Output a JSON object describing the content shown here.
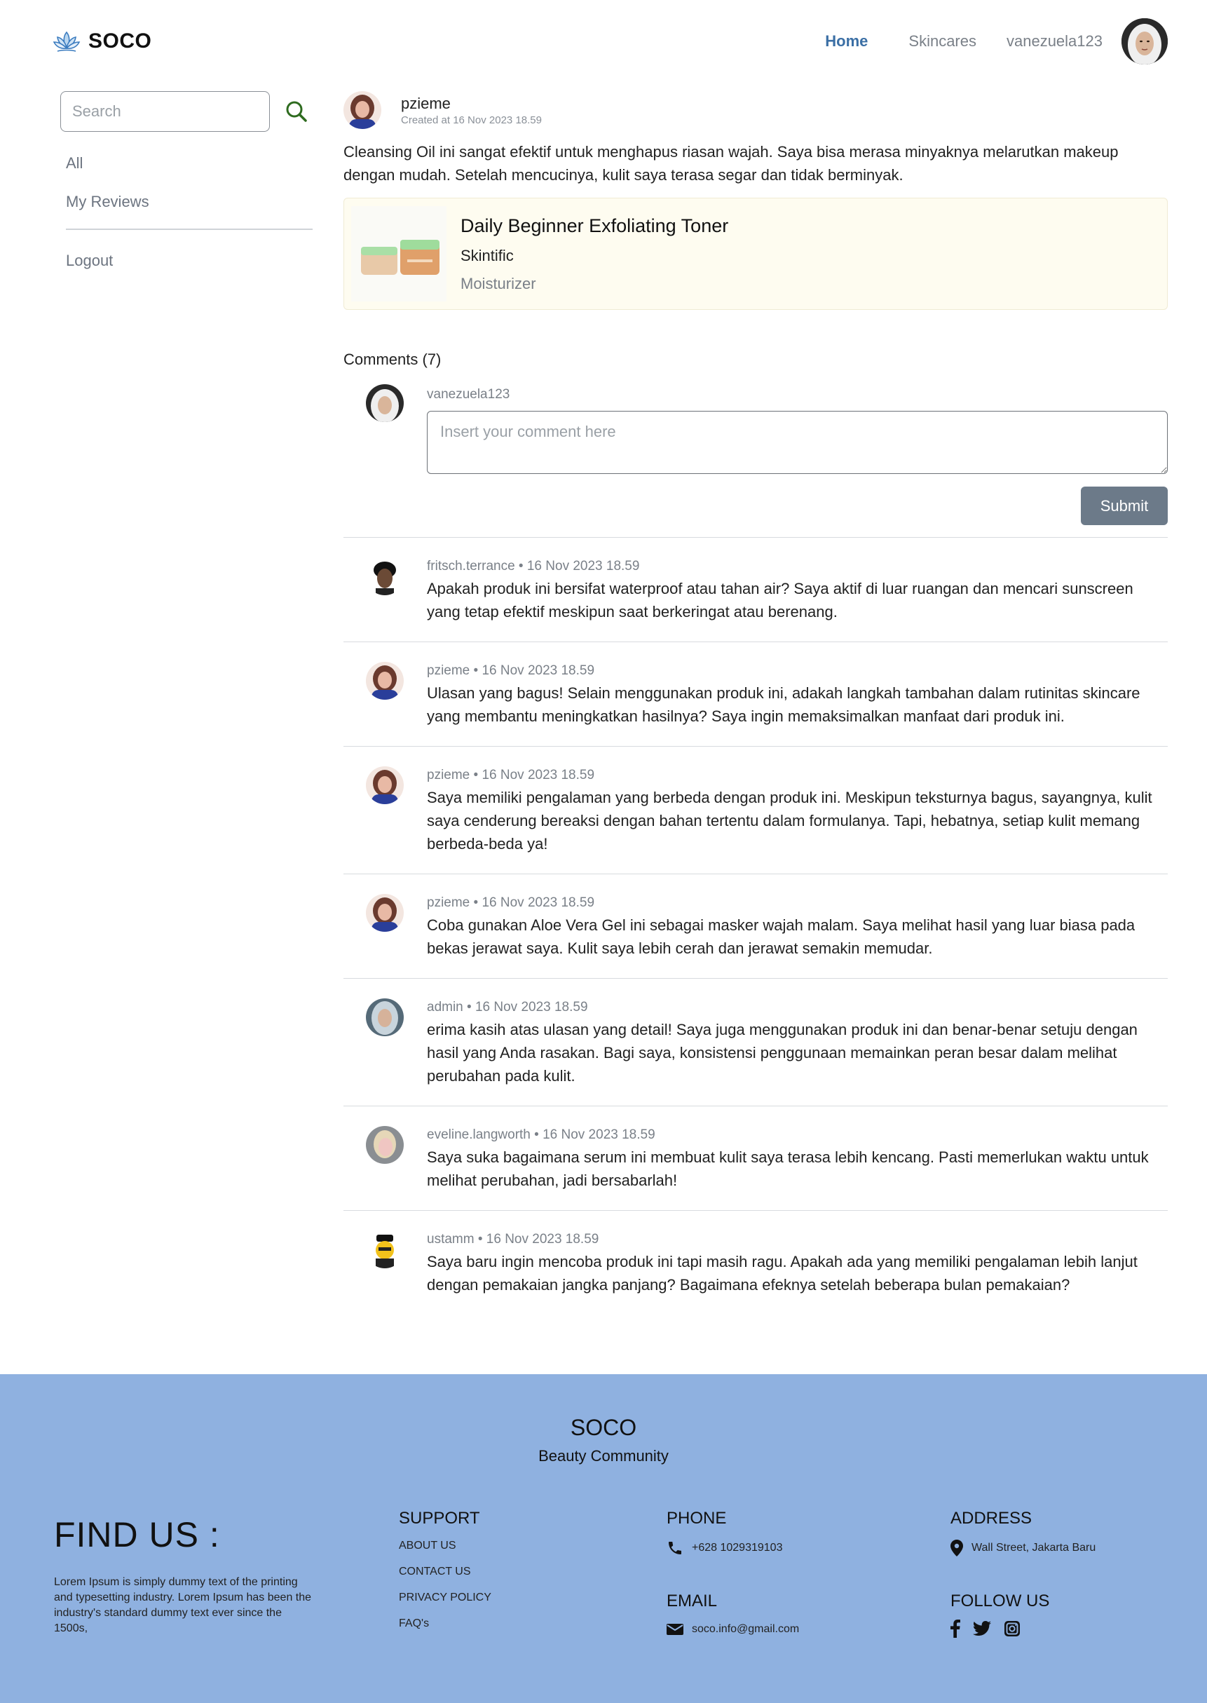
{
  "header": {
    "brand": "SOCO",
    "nav": {
      "home": "Home",
      "skincares": "Skincares",
      "user": "vanezuela123"
    }
  },
  "sidebar": {
    "search_placeholder": "Search",
    "links": [
      "All",
      "My Reviews"
    ],
    "logout": "Logout"
  },
  "post": {
    "author": "pzieme",
    "created": "Created at 16 Nov 2023 18.59",
    "body": "Cleansing Oil ini sangat efektif untuk menghapus riasan wajah. Saya bisa merasa minyaknya melarutkan makeup dengan mudah. Setelah mencucinya, kulit saya terasa segar dan tidak berminyak.",
    "product": {
      "name": "Daily Beginner Exfoliating Toner",
      "brand": "Skintific",
      "category": "Moisturizer"
    }
  },
  "comments_section": {
    "title": "Comments (7)",
    "current_user": "vanezuela123",
    "placeholder": "Insert your comment here",
    "submit_label": "Submit",
    "items": [
      {
        "user": "fritsch.terrance",
        "meta": "fritsch.terrance • 16 Nov 2023 18.59",
        "body": "Apakah produk ini bersifat waterproof atau tahan air? Saya aktif di luar ruangan dan mencari sunscreen yang tetap efektif meskipun saat berkeringat atau berenang."
      },
      {
        "user": "pzieme",
        "meta": "pzieme • 16 Nov 2023 18.59",
        "body": "Ulasan yang bagus! Selain menggunakan produk ini, adakah langkah tambahan dalam rutinitas skincare yang membantu meningkatkan hasilnya? Saya ingin memaksimalkan manfaat dari produk ini."
      },
      {
        "user": "pzieme",
        "meta": "pzieme • 16 Nov 2023 18.59",
        "body": "Saya memiliki pengalaman yang berbeda dengan produk ini. Meskipun teksturnya bagus, sayangnya, kulit saya cenderung bereaksi dengan bahan tertentu dalam formulanya. Tapi, hebatnya, setiap kulit memang berbeda-beda ya!"
      },
      {
        "user": "pzieme",
        "meta": "pzieme • 16 Nov 2023 18.59",
        "body": "Coba gunakan Aloe Vera Gel ini sebagai masker wajah malam. Saya melihat hasil yang luar biasa pada bekas jerawat saya. Kulit saya lebih cerah dan jerawat semakin memudar."
      },
      {
        "user": "admin",
        "meta": "admin • 16 Nov 2023 18.59",
        "body": "erima kasih atas ulasan yang detail! Saya juga menggunakan produk ini dan benar-benar setuju dengan hasil yang Anda rasakan. Bagi saya, konsistensi penggunaan memainkan peran besar dalam melihat perubahan pada kulit."
      },
      {
        "user": "eveline.langworth",
        "meta": "eveline.langworth • 16 Nov 2023 18.59",
        "body": "Saya suka bagaimana serum ini membuat kulit saya terasa lebih kencang. Pasti memerlukan waktu untuk melihat perubahan, jadi bersabarlah!"
      },
      {
        "user": "ustamm",
        "meta": "ustamm • 16 Nov 2023 18.59",
        "body": "Saya baru ingin mencoba produk ini tapi masih ragu. Apakah ada yang memiliki pengalaman lebih lanjut dengan pemakaian jangka panjang? Bagaimana efeknya setelah beberapa bulan pemakaian?"
      }
    ]
  },
  "footer": {
    "brand": "SOCO",
    "tagline": "Beauty Community",
    "find_us": "FIND US :",
    "lorem": "Lorem Ipsum is simply dummy text of the printing and typesetting industry. Lorem Ipsum has been the industry's standard dummy text ever since the 1500s,",
    "support_title": "SUPPORT",
    "support_links": [
      "ABOUT US",
      "CONTACT US",
      "PRIVACY POLICY",
      "FAQ's"
    ],
    "phone_title": "PHONE",
    "phone": "+628 1029319103",
    "email_title": "EMAIL",
    "email": "soco.info@gmail.com",
    "address_title": "ADDRESS",
    "address": "Wall Street, Jakarta Baru",
    "follow_title": "FOLLOW US",
    "social_icons": [
      "facebook-icon",
      "twitter-icon",
      "instagram-icon"
    ]
  },
  "colors": {
    "accent": "#3b6fa5",
    "footer_bg": "#8fb1e0",
    "submit_bg": "#6c7a89",
    "product_card_bg": "#fefcf0",
    "search_icon": "#2e6b1f"
  }
}
